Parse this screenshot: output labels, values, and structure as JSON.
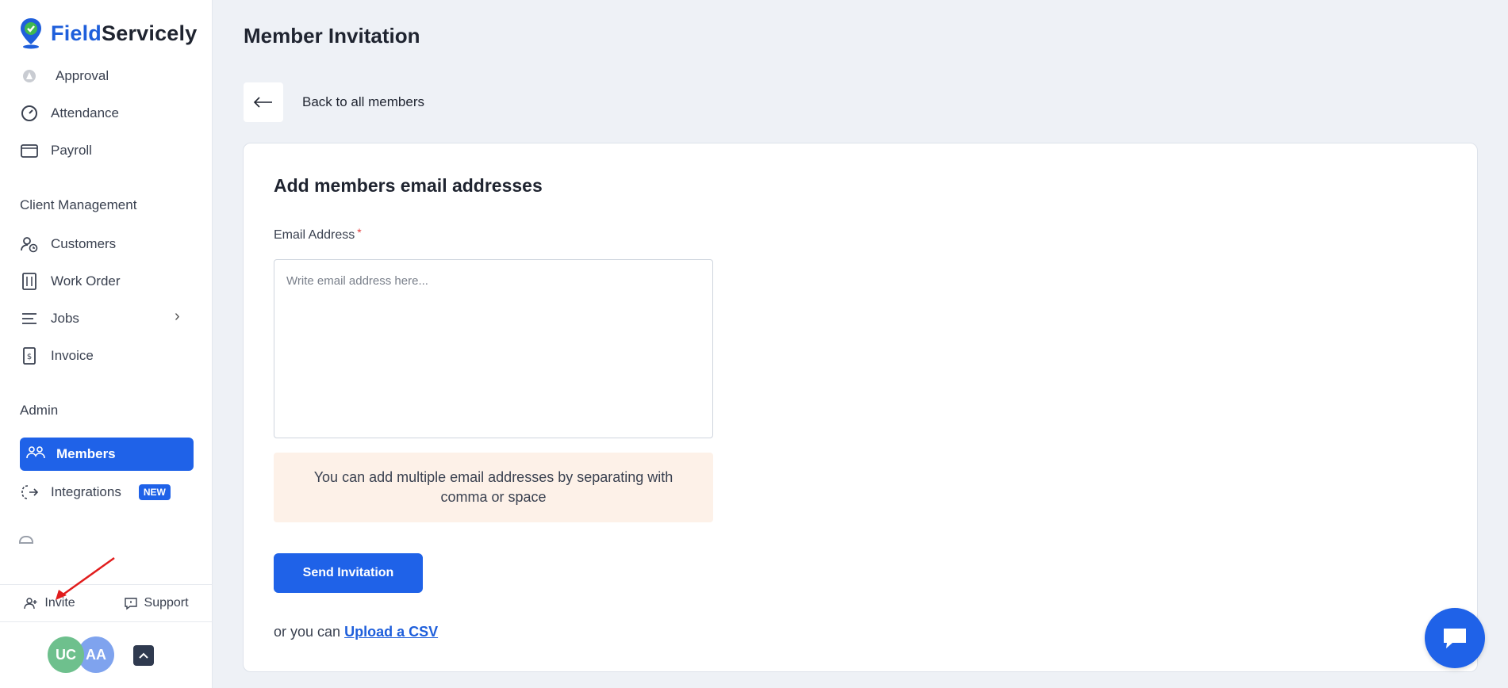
{
  "brand": {
    "name_prefix": "Field",
    "name_suffix": "Servicely",
    "accent_color": "#1f5fdb"
  },
  "sidebar": {
    "top_items": [
      {
        "label": "Approval",
        "icon": "approval-icon"
      },
      {
        "label": "Attendance",
        "icon": "gauge-icon"
      },
      {
        "label": "Payroll",
        "icon": "wallet-icon"
      }
    ],
    "client_section_title": "Client Management",
    "client_items": [
      {
        "label": "Customers",
        "icon": "user-clock-icon"
      },
      {
        "label": "Work Order",
        "icon": "work-order-icon"
      },
      {
        "label": "Jobs",
        "icon": "list-icon"
      },
      {
        "label": "Invoice",
        "icon": "invoice-icon"
      }
    ],
    "admin_section_title": "Admin",
    "admin_items": [
      {
        "label": "Members",
        "icon": "members-icon",
        "active": true
      },
      {
        "label": "Integrations",
        "icon": "integrations-icon",
        "badge": "NEW"
      }
    ],
    "bottom": {
      "invite_label": "Invite",
      "support_label": "Support"
    },
    "avatars": [
      "UC",
      "AA"
    ]
  },
  "main": {
    "page_title": "Member Invitation",
    "back_label": "Back to all members",
    "card": {
      "title": "Add members email addresses",
      "email_label": "Email Address",
      "required_mark": "*",
      "email_placeholder": "Write email address here...",
      "email_value": "",
      "hint": "You can add multiple email addresses by separating with comma or space",
      "send_button": "Send Invitation",
      "csv_prefix": "or you can",
      "csv_link": "Upload a CSV"
    }
  },
  "colors": {
    "primary": "#1f62e8",
    "hint_bg": "#fdf1e8",
    "page_bg": "#eef1f6"
  }
}
